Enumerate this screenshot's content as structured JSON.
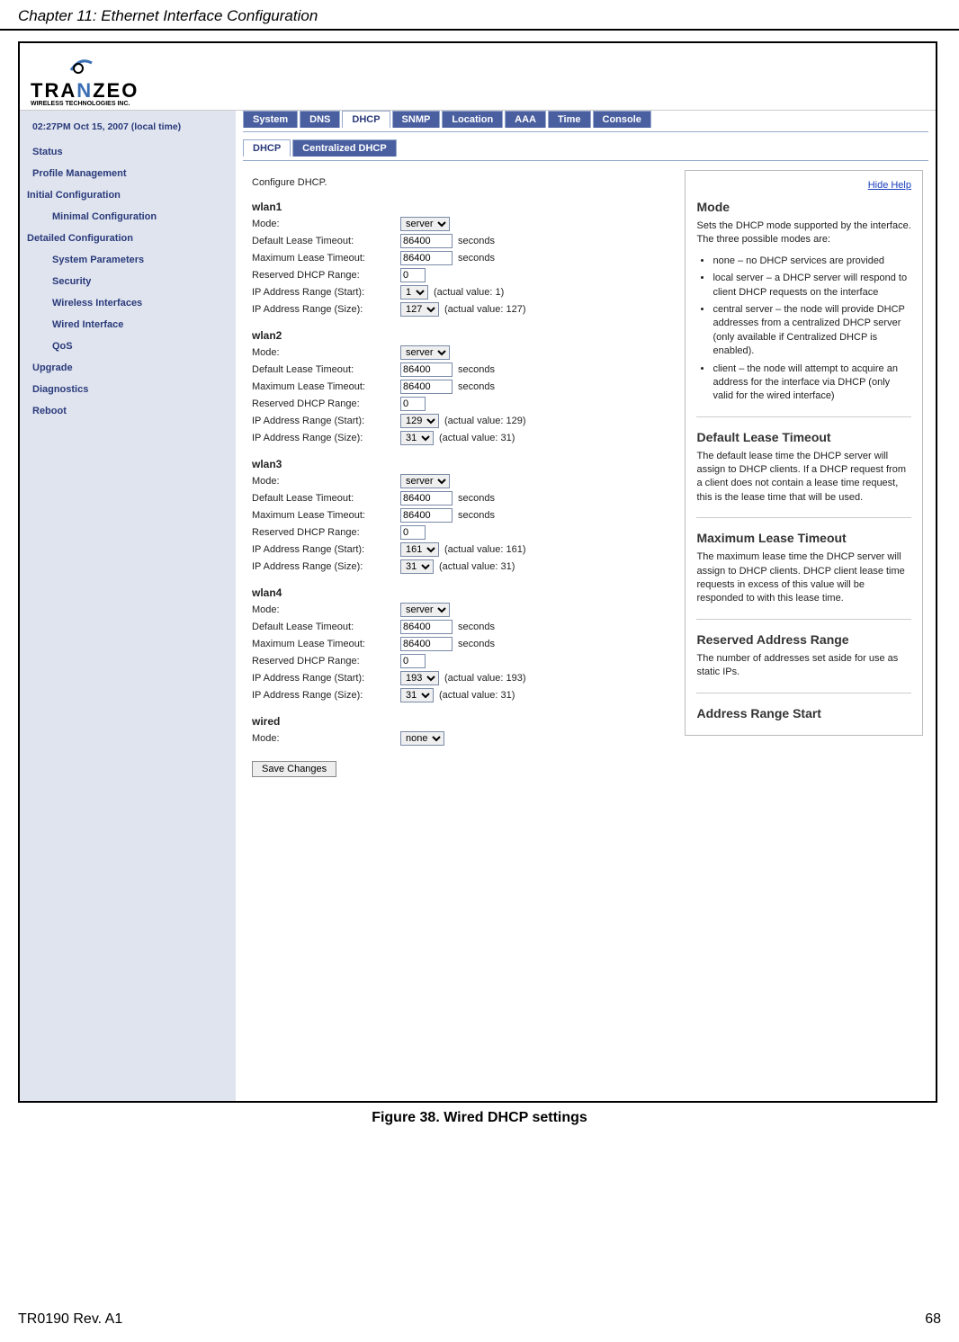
{
  "page": {
    "chapter_header": "Chapter 11: Ethernet Interface Configuration",
    "figure_caption": "Figure 38. Wired DHCP settings",
    "footer_left": "TR0190 Rev. A1",
    "footer_right": "68"
  },
  "logo": {
    "text_pre": "TRA",
    "text_mid": "N",
    "text_post": "ZEO",
    "subtitle": "WIRELESS  TECHNOLOGIES INC."
  },
  "sidebar": {
    "datetime": "02:27PM Oct 15, 2007 (local time)",
    "items": {
      "status": "Status",
      "profile_mgmt": "Profile Management",
      "initial_cfg": "Initial Configuration",
      "minimal_cfg": "Minimal Configuration",
      "detailed_cfg": "Detailed Configuration",
      "sys_params": "System Parameters",
      "security": "Security",
      "wireless_if": "Wireless Interfaces",
      "wired_if": "Wired Interface",
      "qos": "QoS",
      "upgrade": "Upgrade",
      "diagnostics": "Diagnostics",
      "reboot": "Reboot"
    }
  },
  "tabs": {
    "system": "System",
    "dns": "DNS",
    "dhcp": "DHCP",
    "snmp": "SNMP",
    "location": "Location",
    "aaa": "AAA",
    "time": "Time",
    "console": "Console"
  },
  "subtabs": {
    "dhcp": "DHCP",
    "centralized": "Centralized DHCP"
  },
  "content": {
    "intro": "Configure DHCP.",
    "labels": {
      "mode": "Mode:",
      "default_lease": "Default Lease Timeout:",
      "max_lease": "Maximum Lease Timeout:",
      "reserved": "Reserved DHCP Range:",
      "ip_start": "IP Address Range (Start):",
      "ip_size": "IP Address Range (Size):",
      "seconds": "seconds",
      "save": "Save Changes"
    },
    "wlan1": {
      "title": "wlan1",
      "mode": "server",
      "default_lease": "86400",
      "max_lease": "86400",
      "reserved": "0",
      "ip_start": "1",
      "ip_start_actual": "(actual value: 1)",
      "ip_size": "127",
      "ip_size_actual": "(actual value: 127)"
    },
    "wlan2": {
      "title": "wlan2",
      "mode": "server",
      "default_lease": "86400",
      "max_lease": "86400",
      "reserved": "0",
      "ip_start": "129",
      "ip_start_actual": "(actual value: 129)",
      "ip_size": "31",
      "ip_size_actual": "(actual value: 31)"
    },
    "wlan3": {
      "title": "wlan3",
      "mode": "server",
      "default_lease": "86400",
      "max_lease": "86400",
      "reserved": "0",
      "ip_start": "161",
      "ip_start_actual": "(actual value: 161)",
      "ip_size": "31",
      "ip_size_actual": "(actual value: 31)"
    },
    "wlan4": {
      "title": "wlan4",
      "mode": "server",
      "default_lease": "86400",
      "max_lease": "86400",
      "reserved": "0",
      "ip_start": "193",
      "ip_start_actual": "(actual value: 193)",
      "ip_size": "31",
      "ip_size_actual": "(actual value: 31)"
    },
    "wired": {
      "title": "wired",
      "mode": "none"
    }
  },
  "help": {
    "hide_help": "Hide Help",
    "mode_title": "Mode",
    "mode_desc": "Sets the DHCP mode supported by the interface. The three possible modes are:",
    "mode_li1": "none – no DHCP services are provided",
    "mode_li2": "local server – a DHCP server will respond to client DHCP requests on the interface",
    "mode_li3": "central server – the node will provide DHCP addresses from a centralized DHCP server (only available if Centralized DHCP is enabled).",
    "mode_li4": "client – the node will attempt to acquire an address for the interface via DHCP (only valid for the wired interface)",
    "dlt_title": "Default Lease Timeout",
    "dlt_desc": "The default lease time the DHCP server will assign to DHCP clients. If a DHCP request from a client does not contain a lease time request, this is the lease time that will be used.",
    "mlt_title": "Maximum Lease Timeout",
    "mlt_desc": "The maximum lease time the DHCP server will assign to DHCP clients. DHCP client lease time requests in excess of this value will be responded to with this lease time.",
    "rar_title": "Reserved Address Range",
    "rar_desc": "The number of addresses set aside for use as static IPs.",
    "ars_title": "Address Range Start"
  }
}
